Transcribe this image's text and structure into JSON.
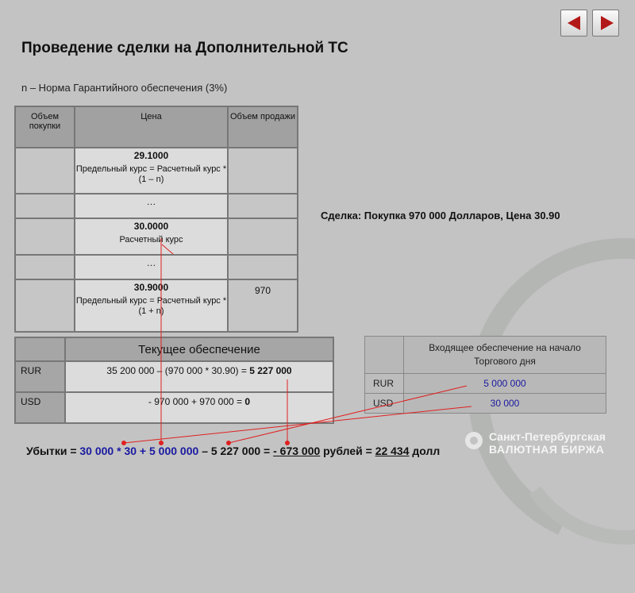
{
  "title": "Проведение сделки на Дополнительной ТС",
  "subtitle": "n – Норма Гарантийного обеспечения (3%)",
  "deal": "Сделка: Покупка 970 000 Долларов, Цена 30.90",
  "main_table": {
    "headers": [
      "Объем покупки",
      "Цена",
      "Объем продажи"
    ],
    "rows": [
      {
        "price": "29.1000",
        "desc": "Предельный курс = Расчетный курс * (1 – n)",
        "sell": ""
      },
      {
        "price": "…",
        "desc": "",
        "sell": ""
      },
      {
        "price": "30.0000",
        "desc": "Расчетный курс",
        "sell": ""
      },
      {
        "price": "…",
        "desc": "",
        "sell": ""
      },
      {
        "price": "30.9000",
        "desc": "Предельный курс = Расчетный курс * (1 + n)",
        "sell": "970"
      }
    ]
  },
  "current_table": {
    "title": "Текущее обеспечение",
    "rows": [
      {
        "label": "RUR",
        "formula": "35 200 000 – (970 000 * 30.90) =",
        "result": "5 227 000"
      },
      {
        "label": "USD",
        "formula": "- 970 000 + 970 000 =",
        "result": "0"
      }
    ]
  },
  "incoming_table": {
    "title": "Входящее обеспечение на начало Торгового дня",
    "rows": [
      {
        "label": "RUR",
        "value": "5 000 000"
      },
      {
        "label": "USD",
        "value": "30 000"
      }
    ]
  },
  "bottom": {
    "prefix": "Убытки =",
    "v1": "30 000",
    "op1": "*",
    "v2": "30",
    "op2": "+",
    "v3": "5 000 000",
    "rest": "– 5 227 000 =",
    "loss_rub": "- 673 000",
    "rub_word": "рублей =",
    "loss_usd": "22 434",
    "usd_word": "долл"
  },
  "exchange": {
    "line1": "Санкт-Петербургская",
    "line2": "ВАЛЮТНАЯ БИРЖА"
  },
  "colors": {
    "accent_red": "#b31818",
    "value_blue": "#1a1aa0",
    "background": "#c3c3c3"
  },
  "icons": [
    "prev-arrow-icon",
    "next-arrow-icon",
    "exchange-logo-icon"
  ]
}
